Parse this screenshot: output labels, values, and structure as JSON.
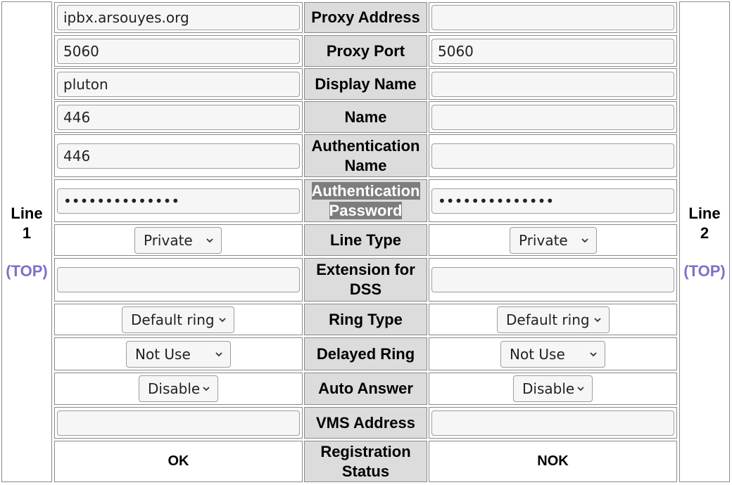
{
  "line1": {
    "title": "Line 1",
    "title_l1": "Line",
    "title_l2": "1",
    "top_link": "(TOP)"
  },
  "line2": {
    "title": "Line 2",
    "title_l1": "Line",
    "title_l2": "2",
    "top_link": "(TOP)"
  },
  "labels": {
    "proxy_address": "Proxy Address",
    "proxy_port": "Proxy Port",
    "display_name": "Display Name",
    "name": "Name",
    "auth_name_l1": "Authentication",
    "auth_name_l2": "Name",
    "auth_password_l1": "Authentication",
    "auth_password_l2": "Password",
    "line_type": "Line Type",
    "ext_dss_l1": "Extension for",
    "ext_dss_l2": "DSS",
    "ring_type": "Ring Type",
    "delayed_ring": "Delayed Ring",
    "auto_answer": "Auto Answer",
    "vms_address": "VMS Address",
    "reg_status_l1": "Registration",
    "reg_status_l2": "Status"
  },
  "left": {
    "proxy_address": "ipbx.arsouyes.org",
    "proxy_port": "5060",
    "display_name": "pluton",
    "name": "446",
    "auth_name": "446",
    "auth_password": "••••••••••••••",
    "line_type": "Private",
    "ext_dss": "",
    "ring_type": "Default ring",
    "delayed_ring": "Not Use",
    "auto_answer": "Disable",
    "vms_address": "",
    "reg_status": "OK"
  },
  "right": {
    "proxy_address": "",
    "proxy_port": "5060",
    "display_name": "",
    "name": "",
    "auth_name": "",
    "auth_password": "••••••••••••••",
    "line_type": "Private",
    "ext_dss": "",
    "ring_type": "Default ring",
    "delayed_ring": "Not Use",
    "auto_answer": "Disable",
    "vms_address": "",
    "reg_status": "NOK"
  },
  "icons": {
    "dropdown": "chevron-down-icon"
  }
}
